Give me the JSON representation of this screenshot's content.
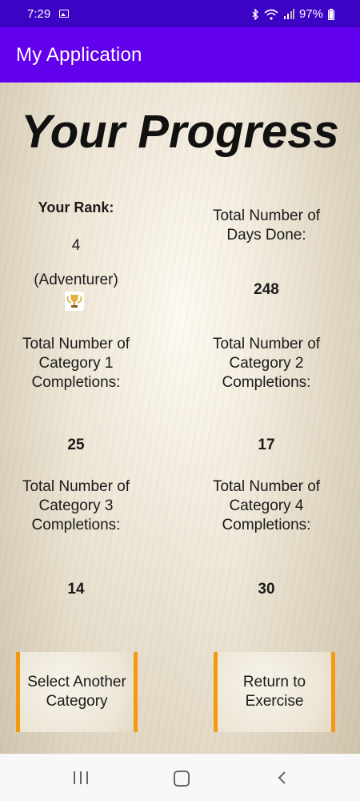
{
  "status_bar": {
    "time": "7:29",
    "battery": "97%",
    "icons": [
      "image-icon",
      "bluetooth-icon",
      "wifi-icon",
      "signal-icon",
      "battery-icon"
    ]
  },
  "app_bar": {
    "title": "My Application",
    "color": "#6200ee"
  },
  "progress": {
    "title": "Your Progress",
    "rank_label": "Your Rank:",
    "rank_value": "4",
    "rank_name": "(Adventurer)",
    "days_label": "Total Number of Days Done:",
    "days_value": "248",
    "category1_label": "Total Number of Category 1 Completions:",
    "category1_value": "25",
    "category2_label": "Total Number of Category 2 Completions:",
    "category2_value": "17",
    "category3_label": "Total Number of Category 3 Completions:",
    "category3_value": "14",
    "category4_label": "Total Number of Category 4 Completions:",
    "category4_value": "30"
  },
  "buttons": {
    "select_category": "Select Another Category",
    "return_exercise": "Return to Exercise",
    "accent_color": "#f39a12"
  },
  "nav_bar": {
    "icons": [
      "recents-icon",
      "home-icon",
      "back-icon"
    ]
  }
}
